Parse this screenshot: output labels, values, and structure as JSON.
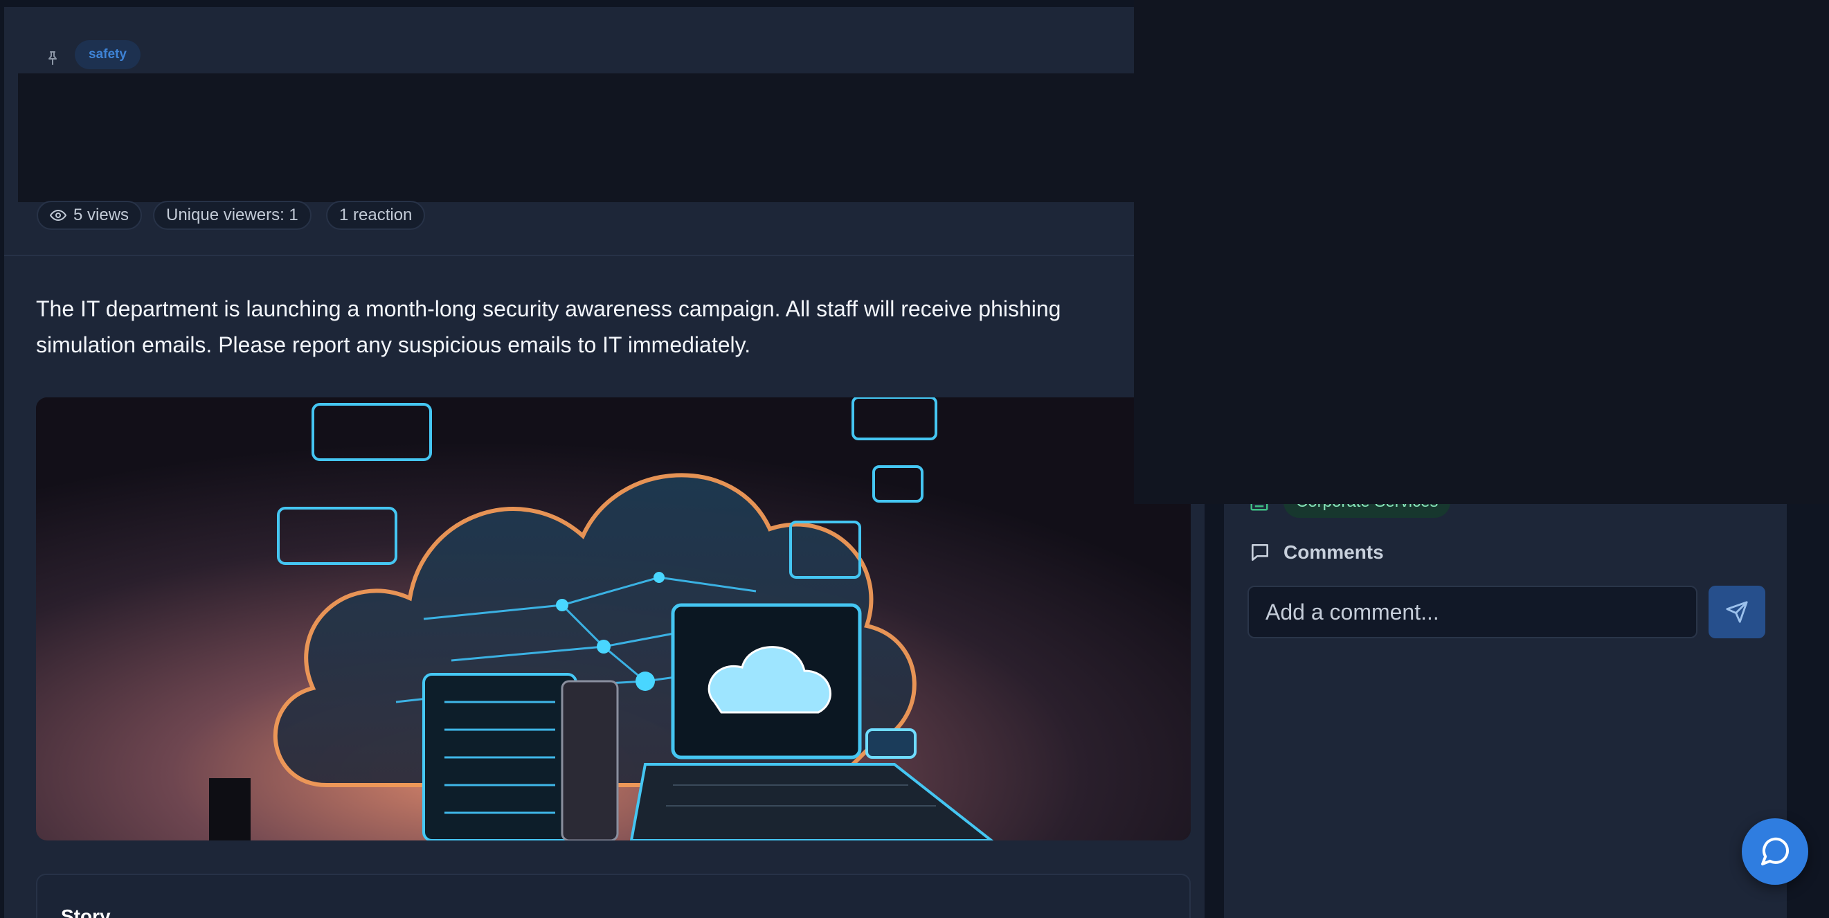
{
  "post": {
    "tag": "safety",
    "stats": {
      "views": "5 views",
      "unique_viewers": "Unique viewers: 1",
      "reactions": "1 reaction"
    },
    "body": "The IT department is launching a month-long security awareness campaign. All staff will receive phishing simulation emails. Please report any suspicious emails to IT immediately.",
    "story_title": "Story"
  },
  "sidebar": {
    "department": "Corporate Services",
    "comments_title": "Comments",
    "comment_placeholder": "Add a comment..."
  },
  "colors": {
    "accent": "#2f7de0",
    "tag_text": "#3e83d6",
    "department_chip": "#86e1b8"
  }
}
